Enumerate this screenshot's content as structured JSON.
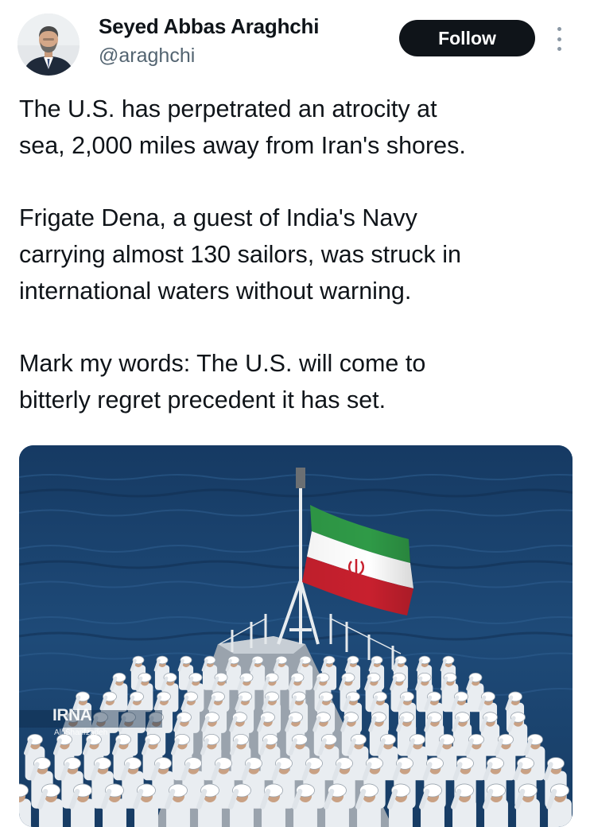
{
  "author": {
    "name": "Seyed Abbas Araghchi",
    "handle": "@araghchi"
  },
  "actions": {
    "follow_label": "Follow",
    "more_icon": "more-vertical-icon"
  },
  "tweet": {
    "paragraphs": [
      [
        "The U.S. has perpetrated an atrocity at",
        "sea, 2,000 miles away from Iran's shores."
      ],
      [
        "Frigate Dena, a guest of India's Navy",
        "carrying almost 130 sailors, was struck in",
        "international waters without warning."
      ],
      [
        "Mark my words: The U.S. will come to",
        "bitterly regret precedent it has set."
      ]
    ]
  },
  "media": {
    "watermark": "IRNA",
    "credit": "Ali Sharifzadeh"
  },
  "colors": {
    "follow_bg": "#0f1419",
    "sea": "#1d3f66",
    "flag_green": "#2f9a47",
    "flag_red": "#c8202e"
  }
}
